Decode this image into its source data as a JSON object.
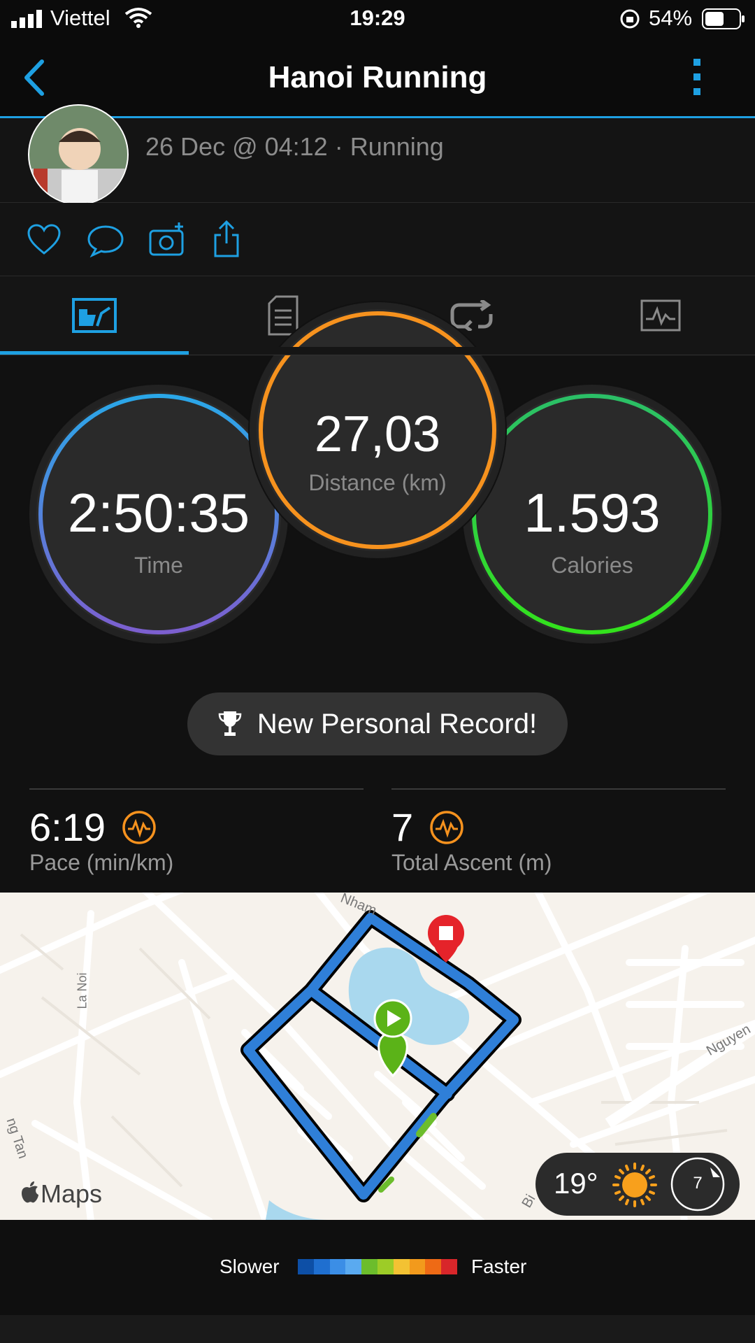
{
  "status_bar": {
    "carrier": "Viettel",
    "time": "19:29",
    "battery_percent": "54%"
  },
  "header": {
    "title": "Hanoi Running"
  },
  "activity": {
    "meta": "26 Dec @ 04:12 · Running"
  },
  "tabs": [
    {
      "icon": "stats-icon",
      "active": true
    },
    {
      "icon": "details-icon",
      "active": false
    },
    {
      "icon": "laps-icon",
      "active": false
    },
    {
      "icon": "charts-icon",
      "active": false
    }
  ],
  "metrics": {
    "time": {
      "value": "2:50:35",
      "label": "Time"
    },
    "distance": {
      "value": "27,03",
      "label": "Distance (km)"
    },
    "calories": {
      "value": "1.593",
      "label": "Calories"
    }
  },
  "personal_record": {
    "label": "New Personal Record!"
  },
  "stats": {
    "pace": {
      "value": "6:19",
      "label": "Pace (min/km)"
    },
    "ascent": {
      "value": "7",
      "label": "Total Ascent (m)"
    }
  },
  "map": {
    "attribution": "Maps",
    "street_labels": [
      "Nham",
      "La Noi",
      "Nguyen",
      "ng Tan",
      "Bi"
    ],
    "weather_temp": "19°",
    "weather_icon": "sun-icon",
    "wind_value": "7"
  },
  "legend": {
    "slower": "Slower",
    "faster": "Faster",
    "colors": [
      "#0d4fa6",
      "#1f6fd0",
      "#3b8ee6",
      "#5aaaf0",
      "#6cbd2c",
      "#9dcc27",
      "#f3c233",
      "#f29a1c",
      "#ee6a15",
      "#d8262a"
    ]
  },
  "colors": {
    "accent": "#1ea0e2",
    "distance_ring": "#f6921e",
    "calories_ring": "#2bd04a",
    "time_ring": "#4a8fe0"
  }
}
